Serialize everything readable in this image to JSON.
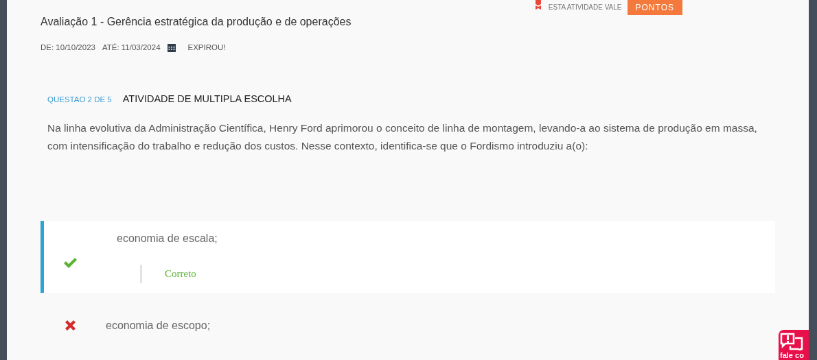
{
  "header": {
    "points_label": "ESTA ATIVIDADE VALE",
    "points_button": "PONTOS"
  },
  "activity": {
    "title": "Avaliação 1 - Gerência estratégica da produção e de operações",
    "from": "DE: 10/10/2023",
    "until": "ATÉ: 11/03/2024",
    "status": "EXPIROU!"
  },
  "question": {
    "counter": "QUESTAO 2 DE 5",
    "type": "ATIVIDADE DE MULTIPLA ESCOLHA",
    "text": "Na linha evolutiva da Administração Científica, Henry Ford aprimorou o conceito de linha de montagem, levando-a ao sistema de produção em massa, com intensificação do trabalho e redução dos custos. Nesse contexto, identifica-se que o Fordismo introduziu a(o):"
  },
  "options": [
    {
      "text": "economia de escala;",
      "kind": "correct",
      "selected": true,
      "feedback": "Correto"
    },
    {
      "text": "economia de escopo;",
      "kind": "wrong",
      "selected": false
    }
  ],
  "chat_widget": {
    "label": "fale co"
  }
}
